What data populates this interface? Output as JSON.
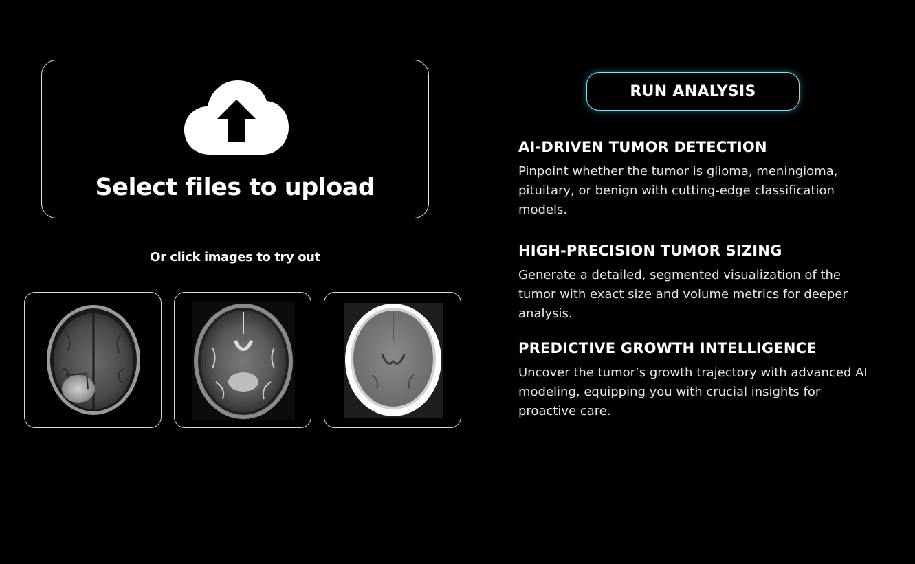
{
  "upload": {
    "title": "Select files to upload",
    "icon": "cloud-upload-icon"
  },
  "samples": {
    "label": "Or click images to try out",
    "items": [
      {
        "kind": "mri-t1-contrast-brain-scan"
      },
      {
        "kind": "mri-t2-brain-scan"
      },
      {
        "kind": "ct-brain-scan"
      }
    ]
  },
  "actions": {
    "run_label": "RUN ANALYSIS",
    "glow_color": "#40bed7"
  },
  "features": [
    {
      "title": "AI-DRIVEN TUMOR DETECTION",
      "description": "Pinpoint whether the tumor is glioma, meningioma, pituitary, or benign with cutting-edge classification models."
    },
    {
      "title": "HIGH-PRECISION TUMOR SIZING",
      "description": "Generate a detailed, segmented visualization of the tumor with exact size and volume metrics for deeper analysis."
    },
    {
      "title": "PREDICTIVE GROWTH INTELLIGENCE",
      "description": "Uncover the tumor’s growth trajectory with advanced AI modeling, equipping you with crucial insights for proactive care."
    }
  ]
}
